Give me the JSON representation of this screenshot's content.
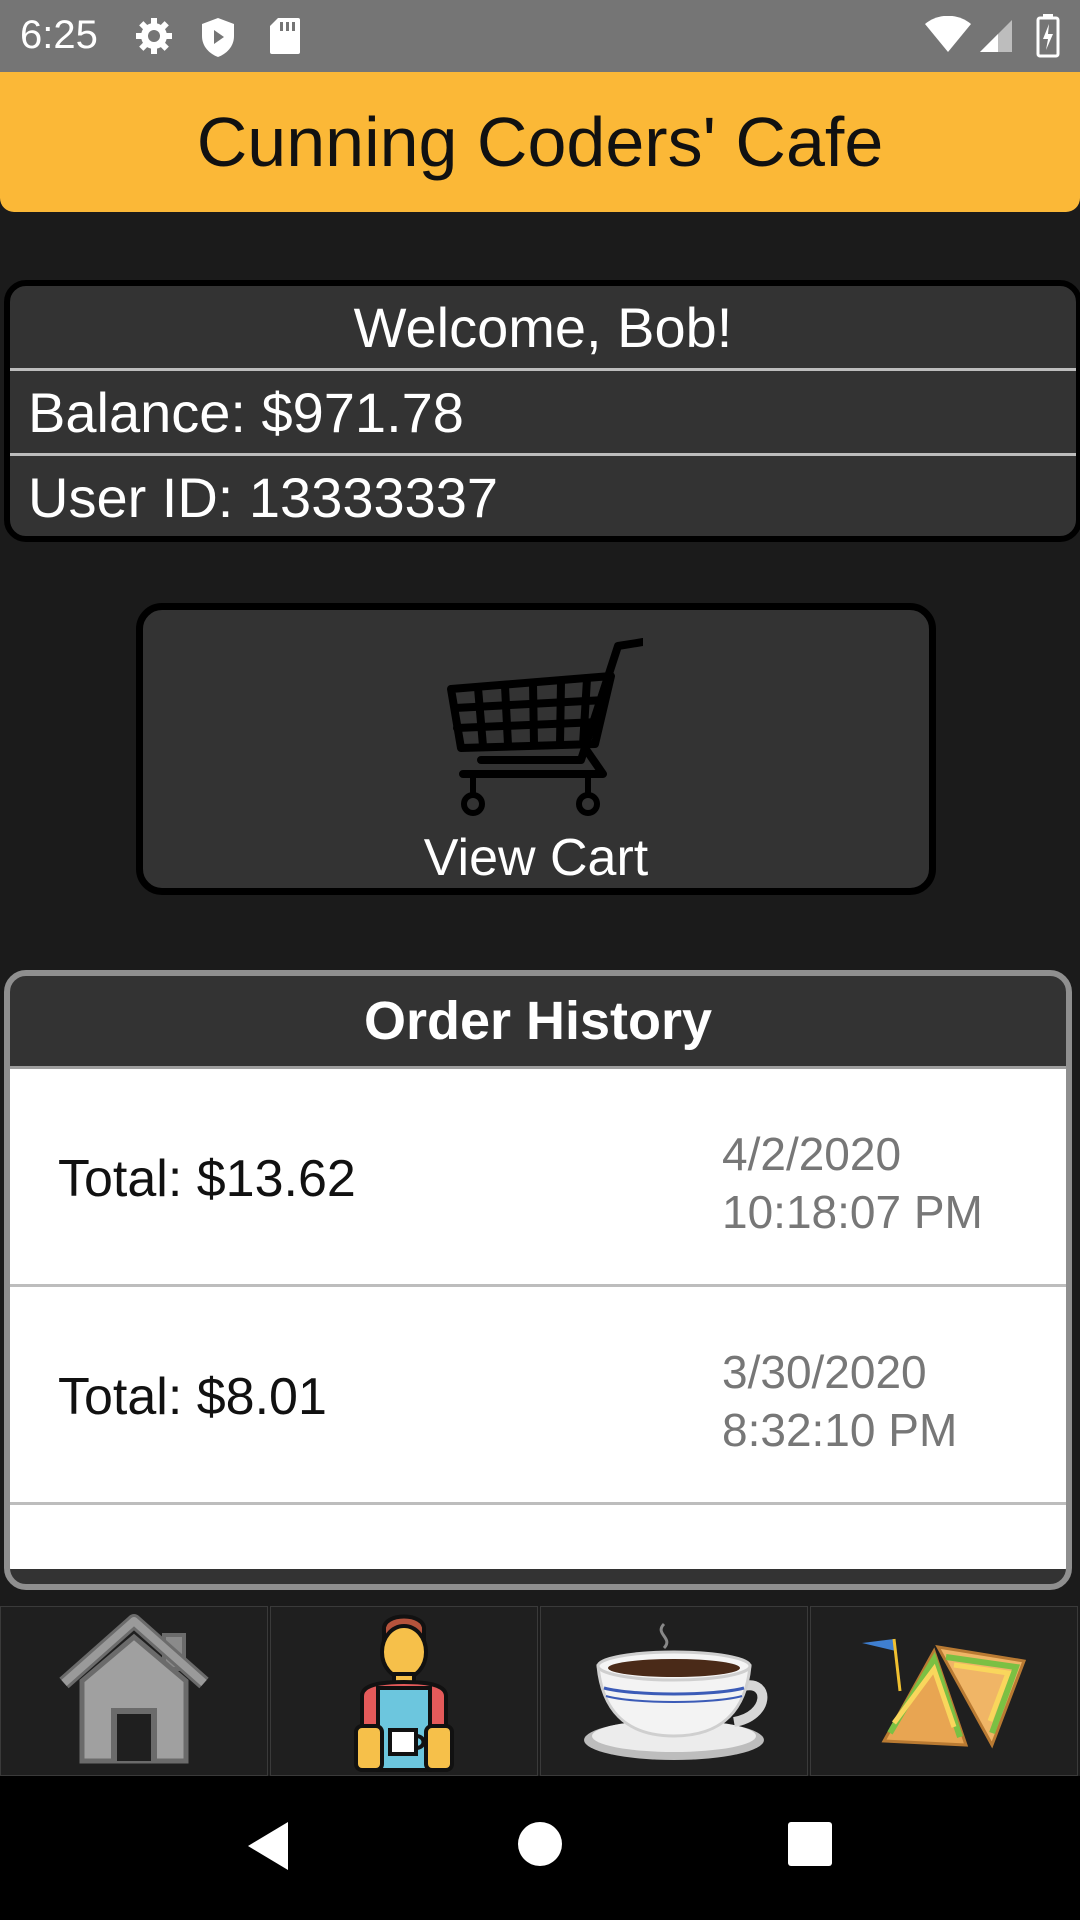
{
  "status_bar": {
    "time": "6:25",
    "icons": [
      "gear-icon",
      "shield-icon",
      "sd-card-icon",
      "wifi-icon",
      "signal-icon",
      "battery-icon"
    ]
  },
  "header": {
    "title": "Cunning Coders' Cafe",
    "color": "#fbb837"
  },
  "user_card": {
    "welcome": "Welcome, Bob!",
    "balance": "Balance: $971.78",
    "user_id": "User ID: 13333337"
  },
  "cart_button": {
    "label": "View Cart",
    "icon": "shopping-cart-icon"
  },
  "order_history": {
    "title": "Order History",
    "orders": [
      {
        "total": "Total: $13.62",
        "date": "4/2/2020",
        "time": "10:18:07 PM"
      },
      {
        "total": "Total: $8.01",
        "date": "3/30/2020",
        "time": "8:32:10 PM"
      }
    ]
  },
  "bottom_nav": {
    "tabs": [
      {
        "name": "home",
        "icon": "house-icon"
      },
      {
        "name": "barista",
        "icon": "barista-icon"
      },
      {
        "name": "coffee",
        "icon": "coffee-cup-icon"
      },
      {
        "name": "sandwich",
        "icon": "sandwich-icon"
      }
    ]
  },
  "system_nav": {
    "buttons": [
      "back-icon",
      "home-circle-icon",
      "recents-icon"
    ]
  }
}
